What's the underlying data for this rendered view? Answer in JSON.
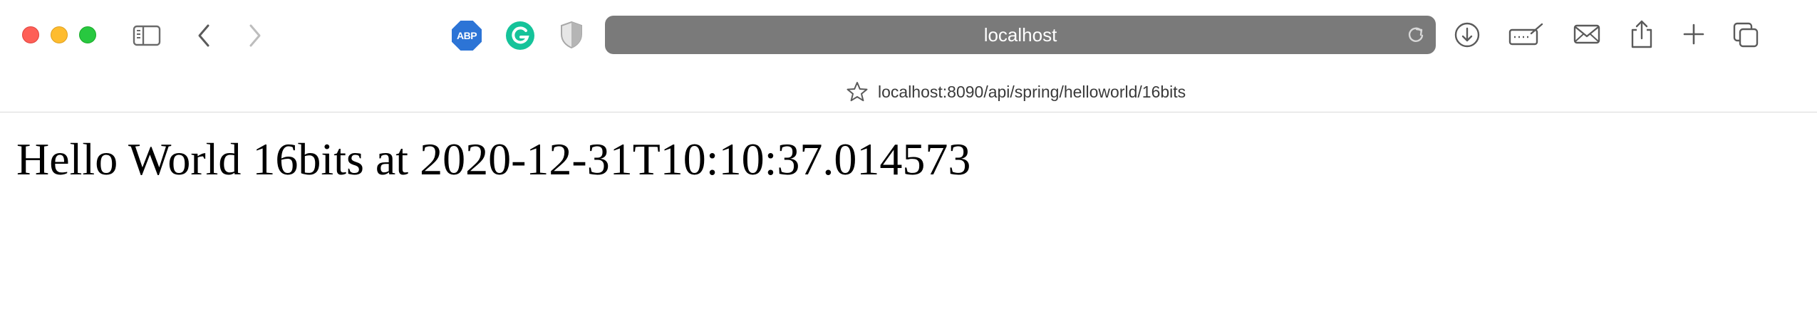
{
  "toolbar": {
    "address": "localhost",
    "extensions": [
      {
        "name": "adblock-plus",
        "label": "ABP",
        "color": "#2c74d6"
      },
      {
        "name": "grammarly",
        "color": "#15c39a"
      },
      {
        "name": "privacy-shield",
        "color": "#b0b0b0"
      }
    ],
    "icons": [
      "sidebar-icon",
      "back-icon",
      "forward-icon",
      "reload-icon",
      "downloads-icon",
      "markup-icon",
      "mail-icon",
      "share-icon",
      "new-tab-icon",
      "tab-overview-icon"
    ]
  },
  "tab": {
    "url": "localhost:8090/api/spring/helloworld/16bits"
  },
  "page": {
    "text": "Hello World 16bits at 2020-12-31T10:10:37.014573"
  },
  "colors": {
    "close": "#fe5f57",
    "minimize": "#febc2e",
    "maximize": "#28c840",
    "urlbar": "#7a7a7a"
  }
}
